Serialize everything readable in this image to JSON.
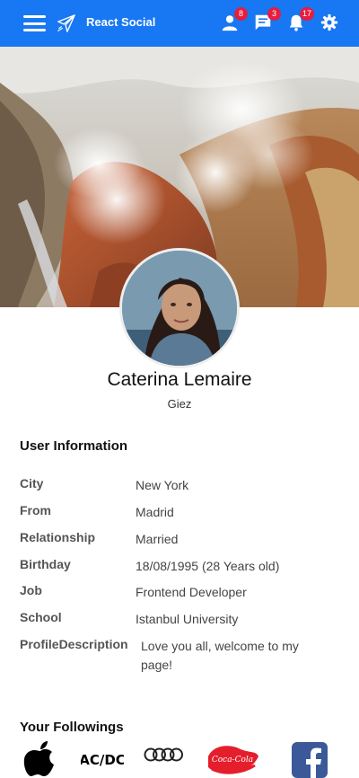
{
  "header": {
    "brand": "React Social",
    "friend_requests_count": "8",
    "messages_count": "3",
    "notifications_count": "17"
  },
  "profile": {
    "name": "Caterina Lemaire",
    "subtitle": "Giez"
  },
  "user_info": {
    "title": "User Information",
    "rows": [
      {
        "key": "City",
        "value": "New York"
      },
      {
        "key": "From",
        "value": "Madrid"
      },
      {
        "key": "Relationship",
        "value": "Married"
      },
      {
        "key": "Birthday",
        "value": "18/08/1995 (28 Years old)"
      },
      {
        "key": "Job",
        "value": "Frontend Developer"
      },
      {
        "key": "School",
        "value": "Istanbul University"
      },
      {
        "key": "ProfileDescription",
        "value": "Love you all, welcome to my page!"
      }
    ]
  },
  "followings": {
    "title": "Your Followings",
    "items": [
      {
        "icon": "apple-logo"
      },
      {
        "icon": "acdc-logo",
        "text": "AC/DC"
      },
      {
        "icon": "audi-logo"
      },
      {
        "icon": "coca-cola-logo",
        "text": "Coca-Cola"
      },
      {
        "icon": "facebook-logo"
      }
    ]
  },
  "colors": {
    "topbar": "#1877f2",
    "badge": "#e41e3f"
  }
}
